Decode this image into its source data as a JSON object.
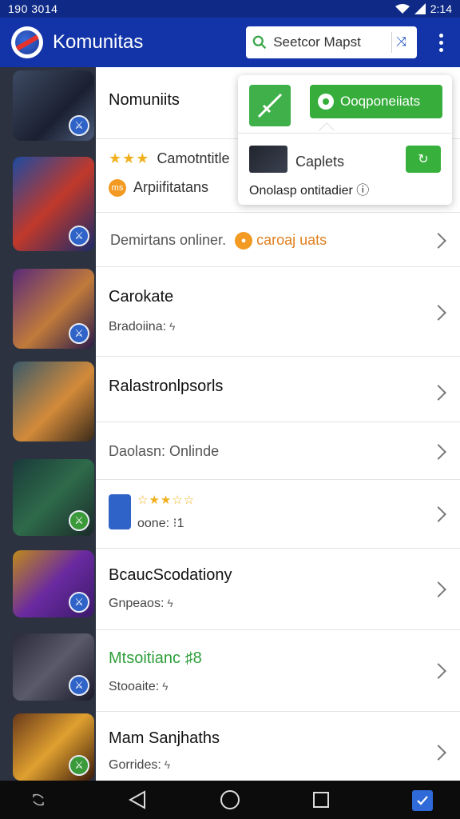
{
  "status_bar": {
    "time": "190 3014",
    "clock": "2:14"
  },
  "app_bar": {
    "title": "Komunitas",
    "search_placeholder": "Seetcor Mapst",
    "logo_icon": "app-logo",
    "search_icon": "search-icon",
    "action_icon": "shuffle-icon",
    "menu_icon": "more-vert-icon"
  },
  "popup": {
    "primary_label": "Ooqponeiiats",
    "item_label": "Caplets",
    "footer_text": "Onolasp ontitadier ⓘ",
    "accent": "#37ad3c"
  },
  "list": {
    "rows": [
      {
        "title": "Nomuniits"
      },
      {
        "title": "Camotntitle",
        "stars": "★★★",
        "sub": "Arpiifitatans",
        "badge": "ms"
      },
      {
        "title": "Demirtans onliner.",
        "chip": "caroaj uats"
      },
      {
        "title": "Carokate",
        "sub": "Bradoiina:"
      },
      {
        "title": "Ralastronlpsorls"
      },
      {
        "title": "Daolasn: Onlinde"
      },
      {
        "title": "",
        "stars": "☆★★☆☆",
        "sub": "oone: ⁝1"
      },
      {
        "title": "BcaucScodationy",
        "sub": "Gnpeaos:"
      },
      {
        "title": "Mtsoitianc ♯8",
        "sub": "Stooaite:",
        "title_color": "#2e9e3a"
      },
      {
        "title": "Mam Sanjhaths",
        "sub": "Gorrides:"
      }
    ]
  },
  "nav_bar": {
    "icons": [
      "rotate-icon",
      "back-icon",
      "home-icon",
      "recents-icon",
      "assistant-icon"
    ]
  },
  "colors": {
    "brand": "#1234a8",
    "status": "#0f2a86",
    "rail": "#2d3240",
    "chip": "#f29a22"
  }
}
